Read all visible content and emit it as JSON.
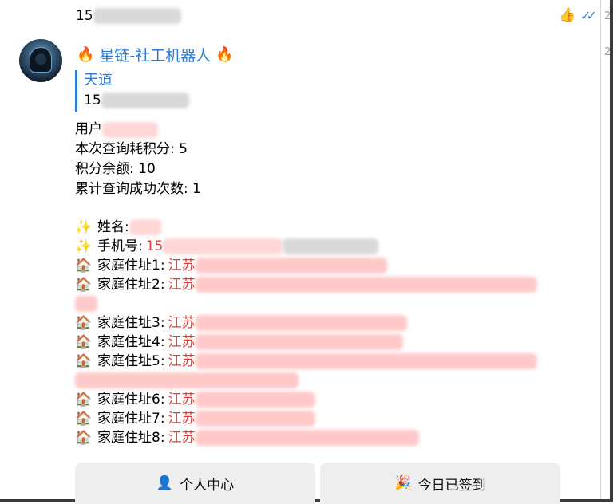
{
  "top_message": {
    "text_prefix": "15",
    "reaction": "👍",
    "status_icon": "double-check"
  },
  "incoming": {
    "sender": "星链-社工机器人",
    "sender_emoji": "🔥",
    "quote": {
      "title": "天道",
      "text_prefix": "15"
    },
    "lines": {
      "user_label": "用户",
      "cost": "本次查询耗积分: 5",
      "balance": "积分余额: 10",
      "success_count": "累计查询成功次数: 1"
    },
    "fields": {
      "name_label": "姓名:",
      "phone_label": "手机号:",
      "phone_prefix": "15"
    },
    "addresses": [
      {
        "label": "家庭住址1:",
        "prefix": "江苏"
      },
      {
        "label": "家庭住址2:",
        "prefix": "江苏"
      },
      {
        "label": "家庭住址3:",
        "prefix": "江苏"
      },
      {
        "label": "家庭住址4:",
        "prefix": "江苏"
      },
      {
        "label": "家庭住址5:",
        "prefix": "江苏"
      },
      {
        "label": "家庭住址6:",
        "prefix": "江苏"
      },
      {
        "label": "家庭住址7:",
        "prefix": "江苏"
      },
      {
        "label": "家庭住址8:",
        "prefix": "江苏"
      }
    ]
  },
  "buttons": [
    {
      "icon": "👤",
      "label": "个人中心"
    },
    {
      "icon": "🎉",
      "label": "今日已签到"
    }
  ],
  "colors": {
    "accent": "#2b7bd6",
    "highlight": "#e53935"
  }
}
